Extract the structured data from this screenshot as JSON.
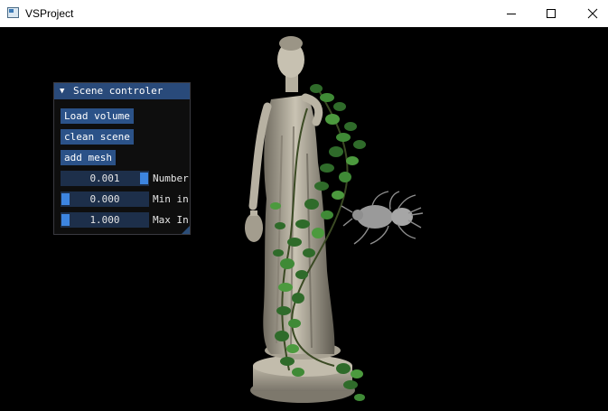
{
  "window": {
    "title": "VSProject",
    "controls": {
      "minimize_icon": "minimize-icon",
      "maximize_icon": "maximize-icon",
      "close_icon": "close-icon"
    }
  },
  "panel": {
    "title": "Scene controler",
    "collapse_icon": "triangle-down-icon",
    "buttons": {
      "load_volume": "Load volume",
      "clean_scene": "clean scene",
      "add_mesh": "add mesh"
    },
    "sliders": [
      {
        "value_text": "0.001",
        "label": "Number",
        "level": 1.0
      },
      {
        "value_text": "0.000",
        "label": "Min in",
        "level": 0.0
      },
      {
        "value_text": "1.000",
        "label": "Max In",
        "level": 0.0
      }
    ]
  },
  "colors": {
    "title_bar": "#ffffff",
    "viewport_background": "#000000",
    "panel_header": "#294a7a",
    "button": "#2b5288",
    "slider_frame": "#1d2f4a",
    "slider_grab": "#3d85e0"
  }
}
